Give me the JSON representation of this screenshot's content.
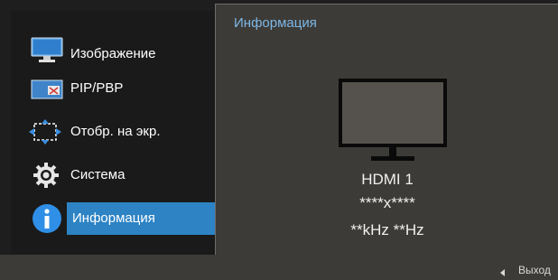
{
  "menu": {
    "items": [
      {
        "label": "Изображение",
        "icon": "display-icon"
      },
      {
        "label": "PIP/PBP",
        "icon": "pip-pbp-icon"
      },
      {
        "label": "Отобр. на экр.",
        "icon": "onscreen-display-icon"
      },
      {
        "label": "Система",
        "icon": "gear-icon"
      },
      {
        "label": "Информация",
        "icon": "info-icon",
        "selected": true
      }
    ]
  },
  "info_panel": {
    "title": "Информация",
    "source": "HDMI 1",
    "resolution": "****x****",
    "frequency": "**kHz **Hz"
  },
  "footer": {
    "exit_label": "Выход"
  },
  "colors": {
    "accent": "#2d83c4",
    "title_text": "#7cb7e6",
    "panel_bg": "#3d3b37",
    "menu_bg": "#1a1a1a"
  }
}
